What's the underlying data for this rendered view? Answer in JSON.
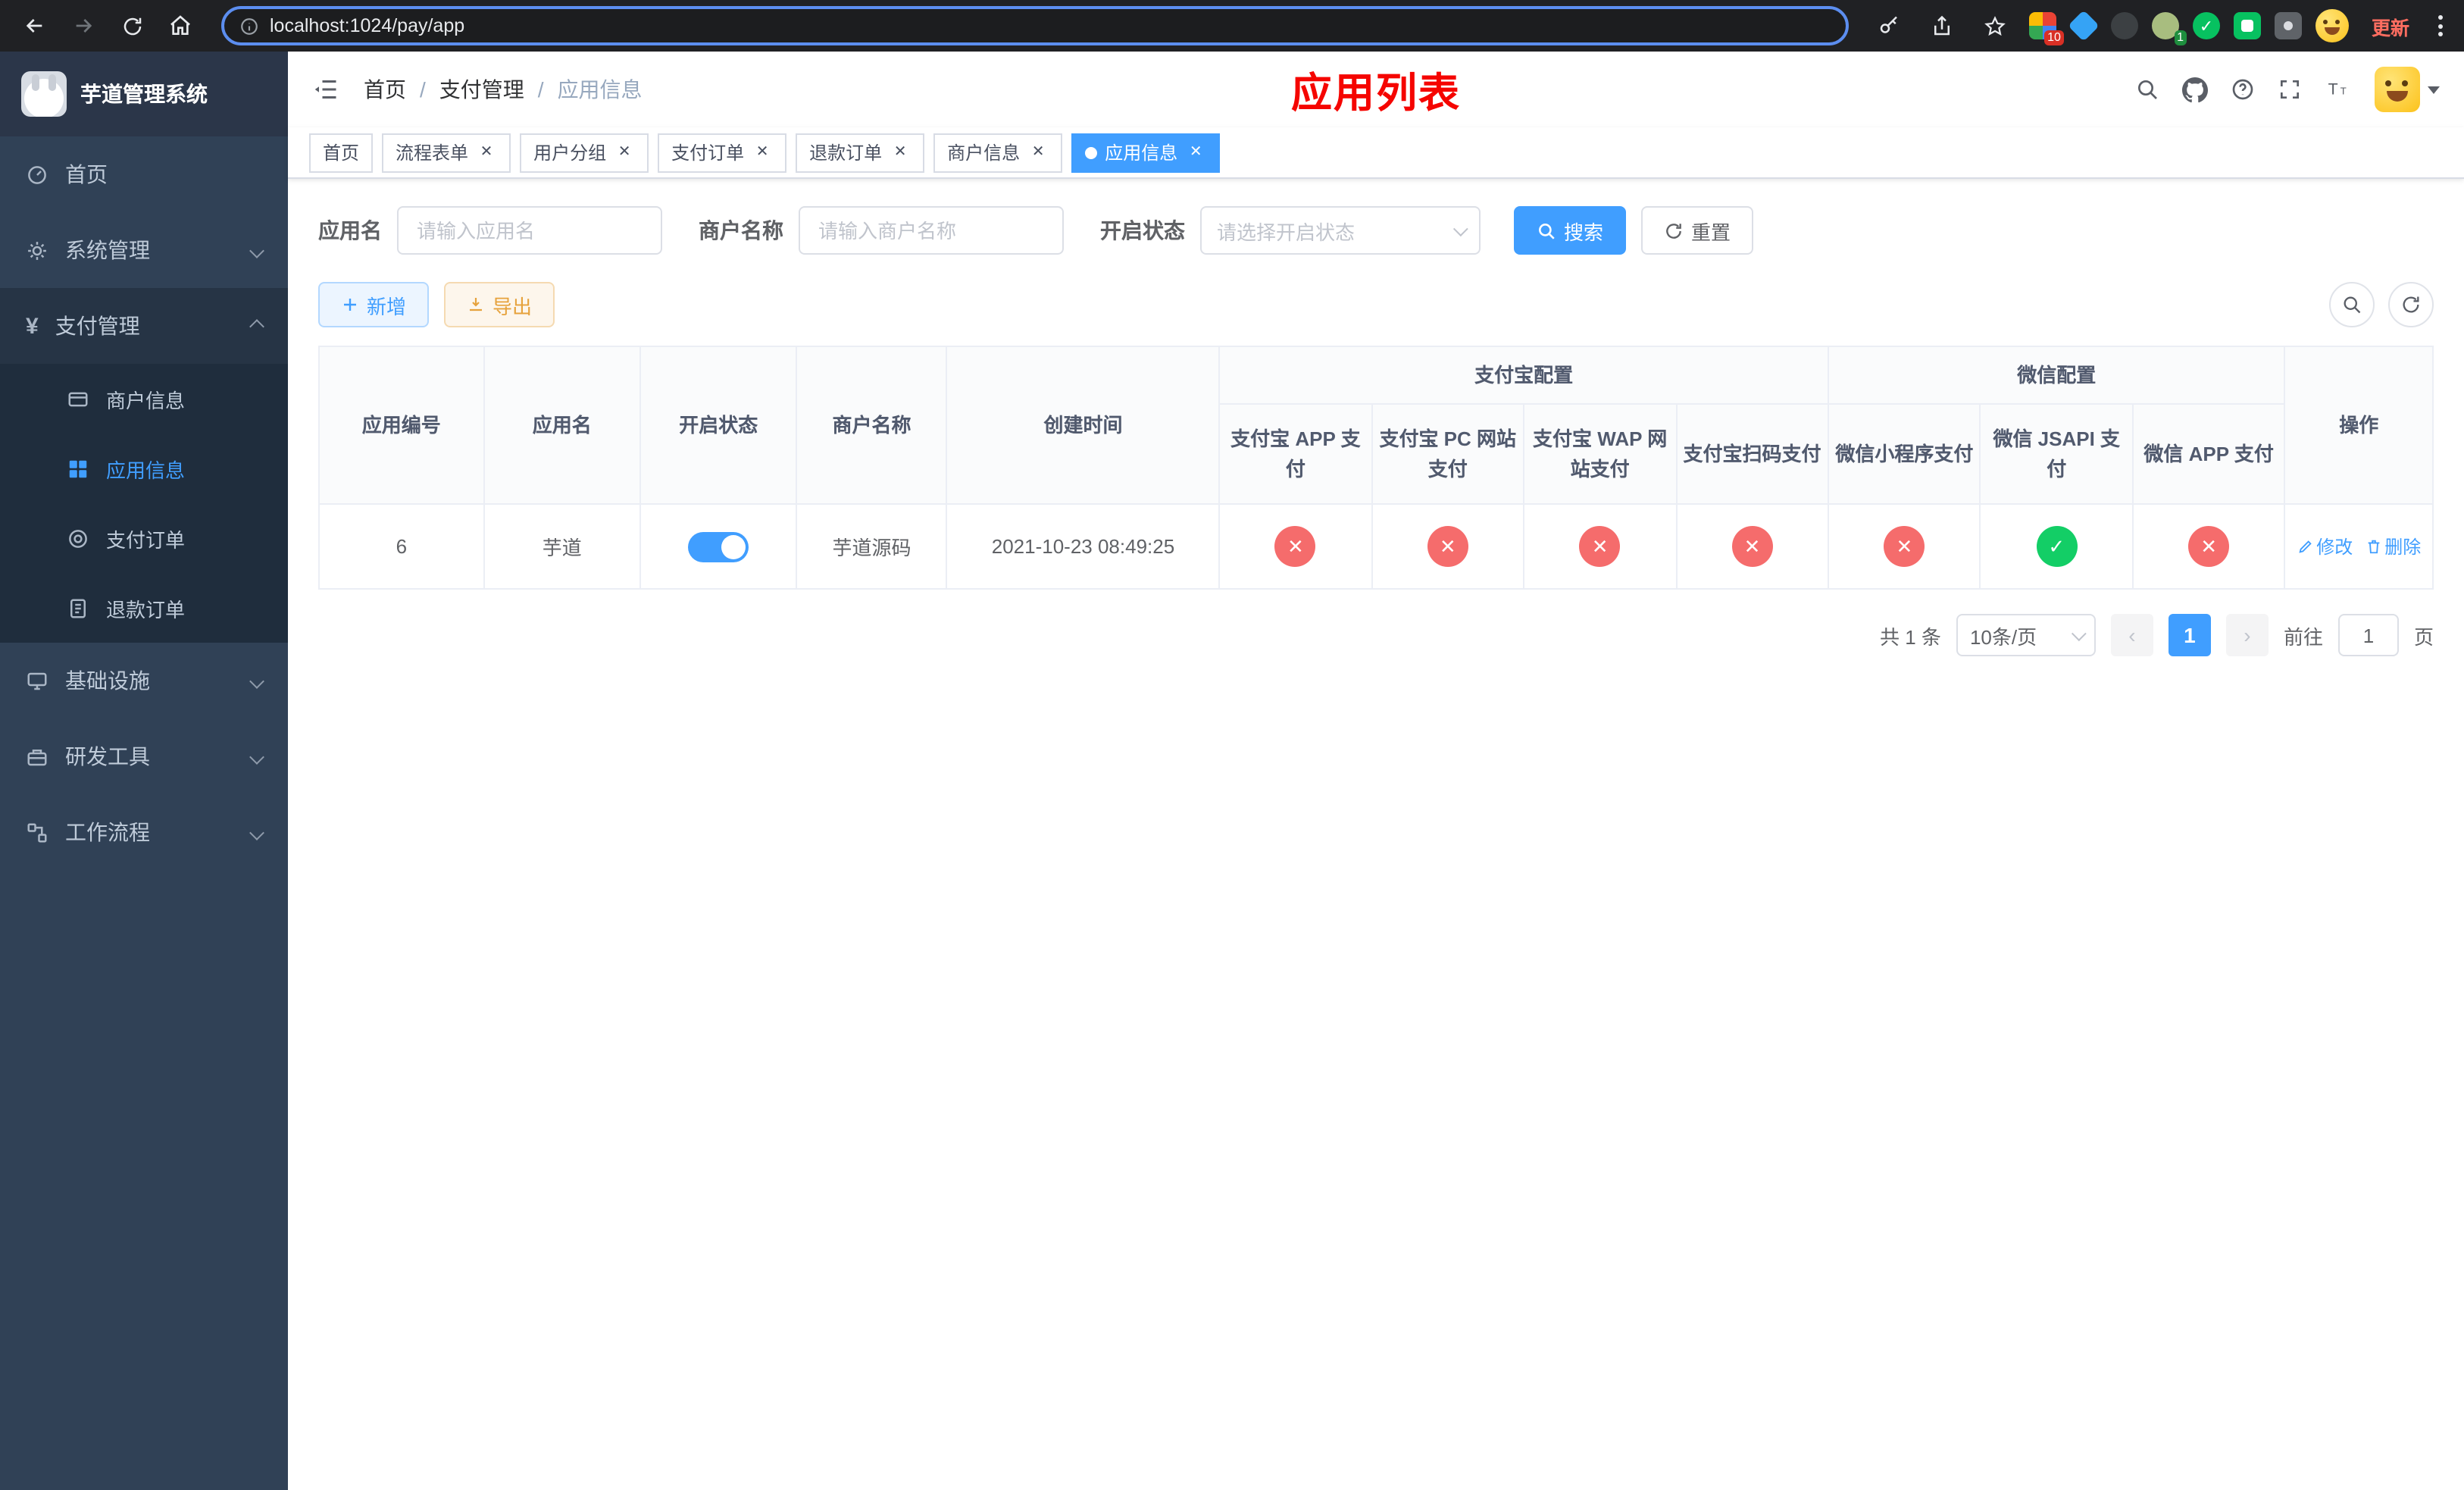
{
  "colors": {
    "accent_blue": "#409EFF",
    "error_red": "#f56c6c",
    "success_green": "#13ce66",
    "warning_orange": "#e6a23c",
    "sidebar_bg": "#304156",
    "submenu_bg": "#1f2d3d",
    "title_red": "#f50500"
  },
  "browser": {
    "url": "localhost:1024/pay/app",
    "update_label": "更新",
    "extension_badge": "10",
    "profile_badge": "1"
  },
  "sidebar": {
    "app_title": "芋道管理系统",
    "home": "首页",
    "system": "系统管理",
    "pay": "支付管理",
    "pay_children": {
      "merchant": "商户信息",
      "app": "应用信息",
      "order": "支付订单",
      "refund": "退款订单"
    },
    "infra": "基础设施",
    "devtools": "研发工具",
    "workflow": "工作流程"
  },
  "header": {
    "breadcrumb": [
      "首页",
      "支付管理",
      "应用信息"
    ],
    "page_title": "应用列表"
  },
  "tabs": [
    {
      "label": "首页",
      "closable": false,
      "active": false
    },
    {
      "label": "流程表单",
      "closable": true,
      "active": false
    },
    {
      "label": "用户分组",
      "closable": true,
      "active": false
    },
    {
      "label": "支付订单",
      "closable": true,
      "active": false
    },
    {
      "label": "退款订单",
      "closable": true,
      "active": false
    },
    {
      "label": "商户信息",
      "closable": true,
      "active": false
    },
    {
      "label": "应用信息",
      "closable": true,
      "active": true
    }
  ],
  "filters": {
    "app_name_label": "应用名",
    "app_name_placeholder": "请输入应用名",
    "merchant_label": "商户名称",
    "merchant_placeholder": "请输入商户名称",
    "status_label": "开启状态",
    "status_placeholder": "请选择开启状态",
    "search_label": "搜索",
    "reset_label": "重置"
  },
  "toolbar": {
    "add_label": "新增",
    "export_label": "导出"
  },
  "table": {
    "columns": {
      "app_id": "应用编号",
      "app_name": "应用名",
      "status": "开启状态",
      "merchant": "商户名称",
      "create_time": "创建时间",
      "alipay_group": "支付宝配置",
      "alipay_app": "支付宝 APP 支付",
      "alipay_pc": "支付宝 PC 网站支付",
      "alipay_wap": "支付宝 WAP 网站支付",
      "alipay_qr": "支付宝扫码支付",
      "wechat_group": "微信配置",
      "wechat_mini": "微信小程序支付",
      "wechat_jsapi": "微信 JSAPI 支付",
      "wechat_app": "微信 APP 支付",
      "actions": "操作"
    },
    "rows": [
      {
        "app_id": "6",
        "app_name": "芋道",
        "status": "on",
        "merchant_name": "芋道源码",
        "create_time": "2021-10-23 08:49:25",
        "alipay_app": "error",
        "alipay_pc": "error",
        "alipay_wap": "error",
        "alipay_qr": "error",
        "wechat_mini": "error",
        "wechat_jsapi": "success",
        "wechat_app": "error",
        "edit_label": "修改",
        "delete_label": "删除"
      }
    ]
  },
  "pagination": {
    "total_text": "共 1 条",
    "page_size": "10条/页",
    "current_page": "1",
    "goto_prefix": "前往",
    "goto_value": "1",
    "goto_suffix": "页"
  },
  "icons": {
    "pay_menu_glyph": "¥",
    "error_glyph": "✕",
    "success_glyph": "✓"
  }
}
